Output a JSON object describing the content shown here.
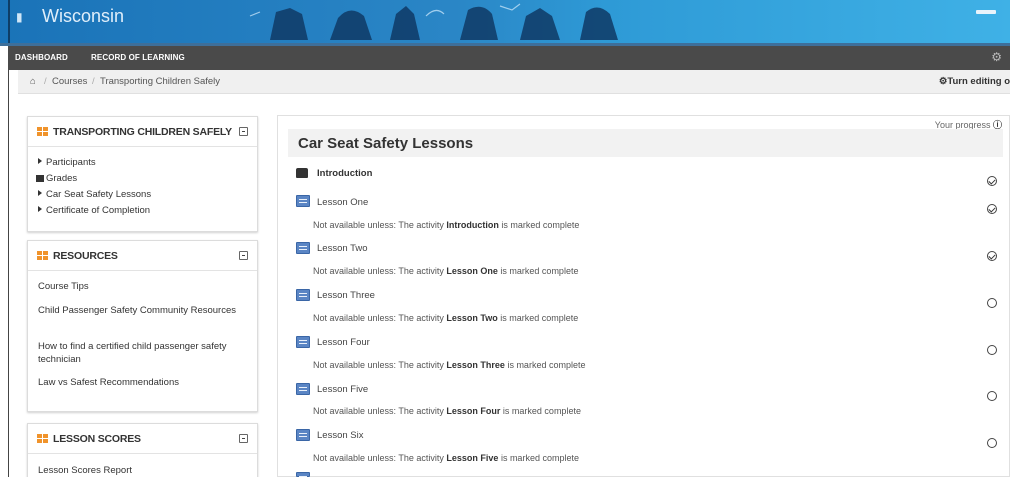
{
  "banner": {
    "title": "Wisconsin"
  },
  "nav": {
    "items": [
      "DASHBOARD",
      "RECORD OF LEARNING"
    ],
    "gear_icon": "gear-icon"
  },
  "breadcrumb": {
    "home_icon": "home-icon",
    "items": [
      "Courses",
      "Transporting Children Safely"
    ],
    "separator": "/"
  },
  "editing": {
    "label": "Turn editing o",
    "icon": "gear-icon"
  },
  "blocks": {
    "course": {
      "title": "TRANSPORTING CHILDREN SAFELY",
      "items": [
        {
          "label": "Participants",
          "icon": "triangle-right-icon"
        },
        {
          "label": "Grades",
          "icon": "table-icon"
        },
        {
          "label": "Car Seat Safety Lessons",
          "icon": "triangle-right-icon"
        },
        {
          "label": "Certificate of Completion",
          "icon": "triangle-right-icon"
        }
      ]
    },
    "resources": {
      "title": "RESOURCES",
      "items": [
        "Course Tips",
        "Child Passenger Safety Community Resources",
        "How to find a certified child passenger safety technician",
        "Law vs Safest Recommendations"
      ]
    },
    "scores": {
      "title": "LESSON SCORES",
      "items": [
        "Lesson Scores Report"
      ]
    }
  },
  "main": {
    "progress_label": "Your progress",
    "section_title": "Car Seat Safety Lessons",
    "restriction_prefix": "Not available unless: The activity ",
    "restriction_suffix": " is marked complete",
    "activities": [
      {
        "name": "Introduction",
        "type": "intro",
        "restricted_by": "",
        "completed": true
      },
      {
        "name": "Lesson One",
        "type": "lesson",
        "restricted_by": "Introduction",
        "completed": true
      },
      {
        "name": "Lesson Two",
        "type": "lesson",
        "restricted_by": "Lesson One",
        "completed": true
      },
      {
        "name": "Lesson Three",
        "type": "lesson",
        "restricted_by": "Lesson Two",
        "completed": false
      },
      {
        "name": "Lesson Four",
        "type": "lesson",
        "restricted_by": "Lesson Three",
        "completed": false
      },
      {
        "name": "Lesson Five",
        "type": "lesson",
        "restricted_by": "Lesson Four",
        "completed": false
      },
      {
        "name": "Lesson Six",
        "type": "lesson",
        "restricted_by": "Lesson Five",
        "completed": false
      }
    ]
  },
  "colors": {
    "banner": "#2a86c6",
    "navbar": "#4a4a4a",
    "block_icon": "#f0932b",
    "lesson_icon": "#5a85c4"
  }
}
